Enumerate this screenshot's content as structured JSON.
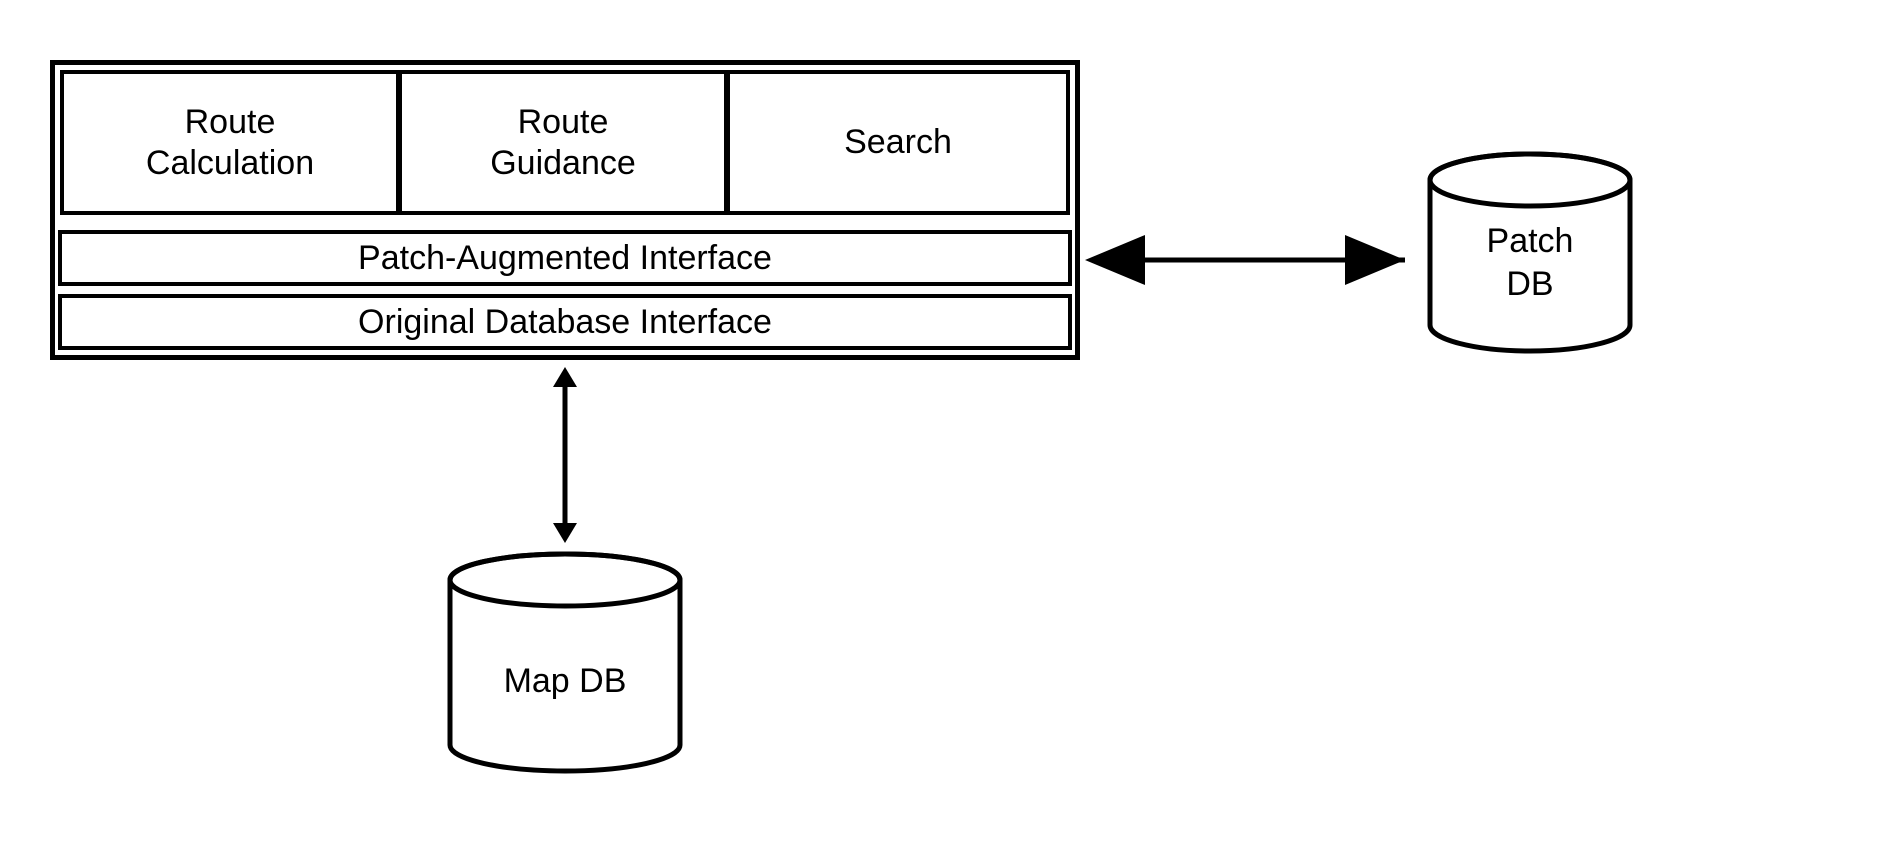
{
  "modules": {
    "route_calculation": "Route\nCalculation",
    "route_guidance": "Route\nGuidance",
    "search": "Search"
  },
  "layers": {
    "patch_interface": "Patch-Augmented Interface",
    "original_interface": "Original Database Interface"
  },
  "databases": {
    "patch_db": "Patch\nDB",
    "map_db": "Map DB"
  }
}
